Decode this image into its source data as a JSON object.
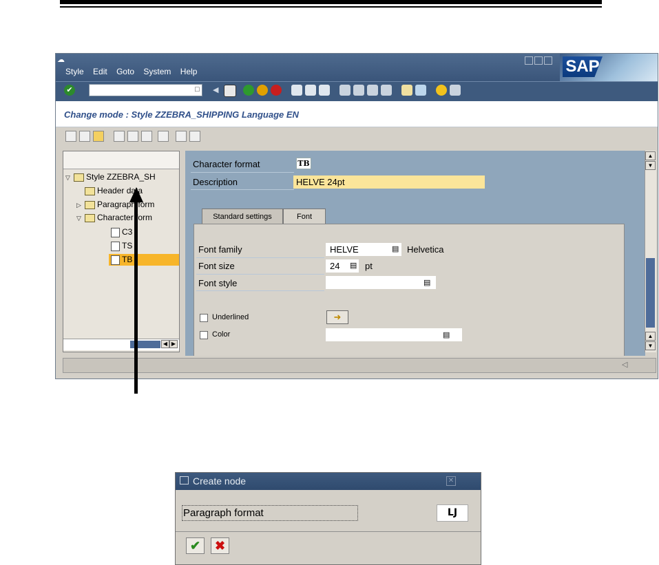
{
  "window": {
    "menu": [
      "Style",
      "Edit",
      "Goto",
      "System",
      "Help"
    ],
    "logo": "SAP",
    "mode_title": "Change mode : Style ZZEBRA_SHIPPING Language EN"
  },
  "tree": {
    "items": [
      {
        "label": "Style ZZEBRA_SH",
        "expanded": true
      },
      {
        "label": "Header data"
      },
      {
        "label": "Paragraph form",
        "expanded": false
      },
      {
        "label": "Character form",
        "expanded": true
      },
      {
        "label": "C3"
      },
      {
        "label": "TS"
      },
      {
        "label": "TB",
        "selected": true
      }
    ]
  },
  "detail": {
    "character_format_label": "Character format",
    "character_format_value": "TB",
    "description_label": "Description",
    "description_value": "HELVE 24pt",
    "tabs": [
      "Standard settings",
      "Font"
    ],
    "active_tab": "Font",
    "font_family_label": "Font family",
    "font_family_value": "HELVE",
    "font_family_text": "Helvetica",
    "font_size_label": "Font size",
    "font_size_value": "24",
    "font_size_unit": "pt",
    "font_style_label": "Font style",
    "font_style_value": "",
    "underlined_label": "Underlined",
    "color_label": "Color",
    "color_value": ""
  },
  "dialog": {
    "title": "Create node",
    "input_value": "Paragraph format",
    "code": "LJ"
  },
  "colors": {
    "title_bar": "#3e5a7e",
    "tree_selection": "#f7b52a",
    "description_field": "#fbe59a",
    "panel_bg": "#8fa6bb"
  }
}
